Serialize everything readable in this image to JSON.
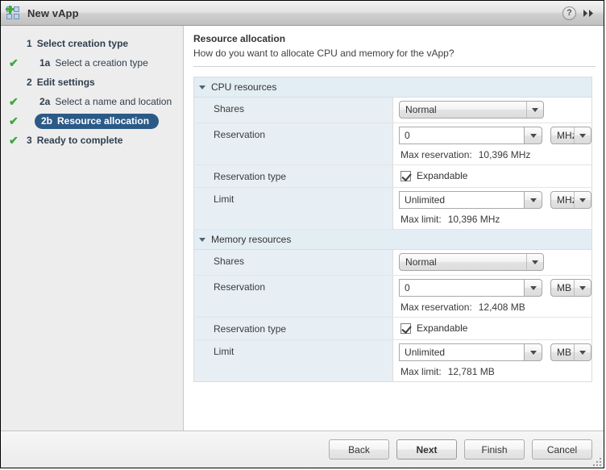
{
  "window": {
    "title": "New vApp",
    "icon": "vapp-icon",
    "help_button": "?",
    "expand_button": "»"
  },
  "sidebar": {
    "items": [
      {
        "number": "1",
        "label": "Select creation type",
        "level": "major",
        "checked": false,
        "selected": false
      },
      {
        "number": "1a",
        "label": "Select a creation type",
        "level": "sub",
        "checked": true,
        "selected": false
      },
      {
        "number": "2",
        "label": "Edit settings",
        "level": "major",
        "checked": false,
        "selected": false
      },
      {
        "number": "2a",
        "label": "Select a name and location",
        "level": "sub",
        "checked": true,
        "selected": false
      },
      {
        "number": "2b",
        "label": "Resource allocation",
        "level": "sub",
        "checked": true,
        "selected": true
      },
      {
        "number": "3",
        "label": "Ready to complete",
        "level": "major",
        "checked": true,
        "selected": false
      }
    ],
    "check_glyph": "✔"
  },
  "header": {
    "title": "Resource allocation",
    "subtitle": "How do you want to allocate CPU and memory for the vApp?"
  },
  "sections": [
    {
      "id": "cpu",
      "title": "CPU resources",
      "shares_label": "Shares",
      "shares_value": "Normal",
      "reservation_label": "Reservation",
      "reservation_value": "0",
      "reservation_unit": "MHz",
      "max_reservation_label": "Max reservation:",
      "max_reservation_value": "10,396 MHz",
      "reservation_type_label": "Reservation type",
      "expandable_label": "Expandable",
      "expandable_checked": true,
      "limit_label": "Limit",
      "limit_value": "Unlimited",
      "limit_unit": "MHz",
      "max_limit_label": "Max limit:",
      "max_limit_value": "10,396 MHz"
    },
    {
      "id": "memory",
      "title": "Memory resources",
      "shares_label": "Shares",
      "shares_value": "Normal",
      "reservation_label": "Reservation",
      "reservation_value": "0",
      "reservation_unit": "MB",
      "max_reservation_label": "Max reservation:",
      "max_reservation_value": "12,408 MB",
      "reservation_type_label": "Reservation type",
      "expandable_label": "Expandable",
      "expandable_checked": true,
      "limit_label": "Limit",
      "limit_value": "Unlimited",
      "limit_unit": "MB",
      "max_limit_label": "Max limit:",
      "max_limit_value": "12,781 MB"
    }
  ],
  "footer": {
    "back": "Back",
    "next": "Next",
    "finish": "Finish",
    "cancel": "Cancel"
  },
  "colors": {
    "selected_nav": "#2c5a87",
    "check_green": "#3ea83e",
    "section_header_bg": "#e3edf4",
    "label_cell_bg": "#e7eff5",
    "sidebar_bg": "#ededed"
  }
}
